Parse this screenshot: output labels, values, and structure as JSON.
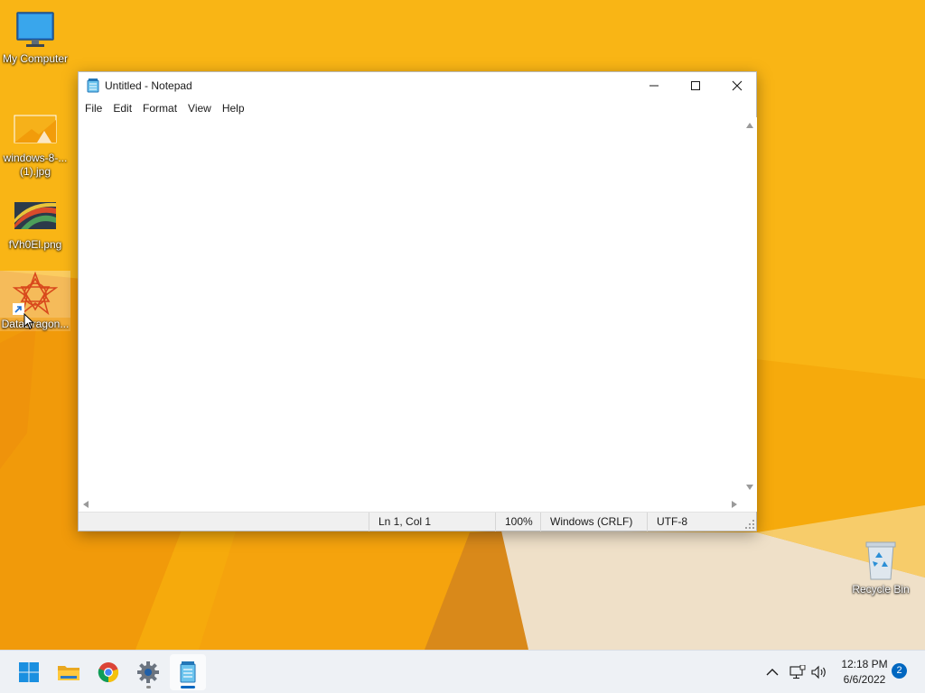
{
  "desktop": {
    "icons": [
      {
        "label": "My Computer"
      },
      {
        "label": "windows-8-...(1).jpg"
      },
      {
        "label": "fVh0El.png"
      },
      {
        "label": "DataDragon..."
      },
      {
        "label": "Recycle Bin"
      }
    ]
  },
  "notepad": {
    "title": "Untitled - Notepad",
    "menu": [
      "File",
      "Edit",
      "Format",
      "View",
      "Help"
    ],
    "content": "",
    "status": {
      "position": "Ln 1, Col 1",
      "zoom": "100%",
      "line_ending": "Windows (CRLF)",
      "encoding": "UTF-8"
    }
  },
  "taskbar": {
    "apps": [
      {
        "name": "start-button"
      },
      {
        "name": "file-explorer"
      },
      {
        "name": "chrome"
      },
      {
        "name": "settings"
      },
      {
        "name": "notepad"
      }
    ],
    "clock": {
      "time": "12:18 PM",
      "date": "6/6/2022"
    },
    "notification_count": "2"
  },
  "colors": {
    "wallpaper_base": "#f4a60a",
    "accent": "#0067c0",
    "taskbar_bg": "#eef1f5"
  }
}
